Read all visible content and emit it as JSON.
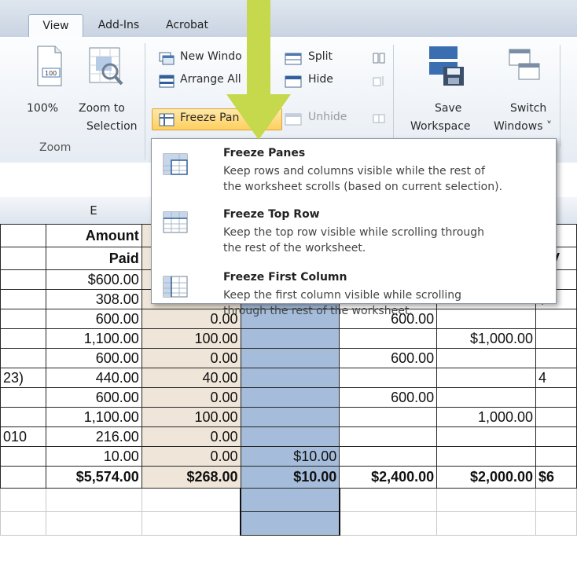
{
  "ribbon": {
    "tabs": [
      "View",
      "Add-Ins",
      "Acrobat"
    ],
    "zoom_group": {
      "btn_100": "100%",
      "btn_zoom_sel_1": "Zoom to",
      "btn_zoom_sel_2": "Selection",
      "label": "Zoom",
      "mini_100": "100"
    },
    "window_group": {
      "new_window": "New Windo",
      "arrange_all": "Arrange All",
      "freeze_panes": "Freeze Pan",
      "split": "Split",
      "hide": "Hide",
      "unhide": "Unhide"
    },
    "save_workspace_1": "Save",
    "save_workspace_2": "Workspace",
    "switch_windows_1": "Switch",
    "switch_windows_2": "Windows ˅"
  },
  "menu": {
    "items": [
      {
        "title": "Freeze Panes",
        "desc1": "Keep rows and columns visible while the rest of",
        "desc2": "the worksheet scrolls (based on current selection)."
      },
      {
        "title": "Freeze Top Row",
        "desc1": "Keep the top row visible while scrolling through",
        "desc2": "the rest of the worksheet."
      },
      {
        "title": "Freeze First Column",
        "desc1": "Keep the first column visible while scrolling",
        "desc2": "through the rest of the worksheet."
      }
    ]
  },
  "sheet": {
    "col_e": "E",
    "header_amount": "Amount",
    "header_paid": "Paid",
    "header_mv": "MV",
    "rows": [
      [
        "",
        "$600.00",
        "",
        "",
        "",
        "",
        ""
      ],
      [
        "",
        "308.00",
        "",
        "",
        "",
        "",
        "$2"
      ],
      [
        "",
        "600.00",
        "0.00",
        "",
        "600.00",
        "",
        ""
      ],
      [
        "",
        "1,100.00",
        "100.00",
        "",
        "",
        "$1,000.00",
        ""
      ],
      [
        "",
        "600.00",
        "0.00",
        "",
        "600.00",
        "",
        ""
      ],
      [
        "23)",
        "440.00",
        "40.00",
        "",
        "",
        "",
        "4"
      ],
      [
        "",
        "600.00",
        "0.00",
        "",
        "600.00",
        "",
        ""
      ],
      [
        "",
        "1,100.00",
        "100.00",
        "",
        "",
        "1,000.00",
        ""
      ],
      [
        "010",
        "216.00",
        "0.00",
        "",
        "",
        "",
        ""
      ],
      [
        "",
        "10.00",
        "0.00",
        "$10.00",
        "",
        "",
        ""
      ]
    ],
    "total": [
      "",
      "$5,574.00",
      "$268.00",
      "$10.00",
      "$2,400.00",
      "$2,000.00",
      "$6"
    ]
  }
}
